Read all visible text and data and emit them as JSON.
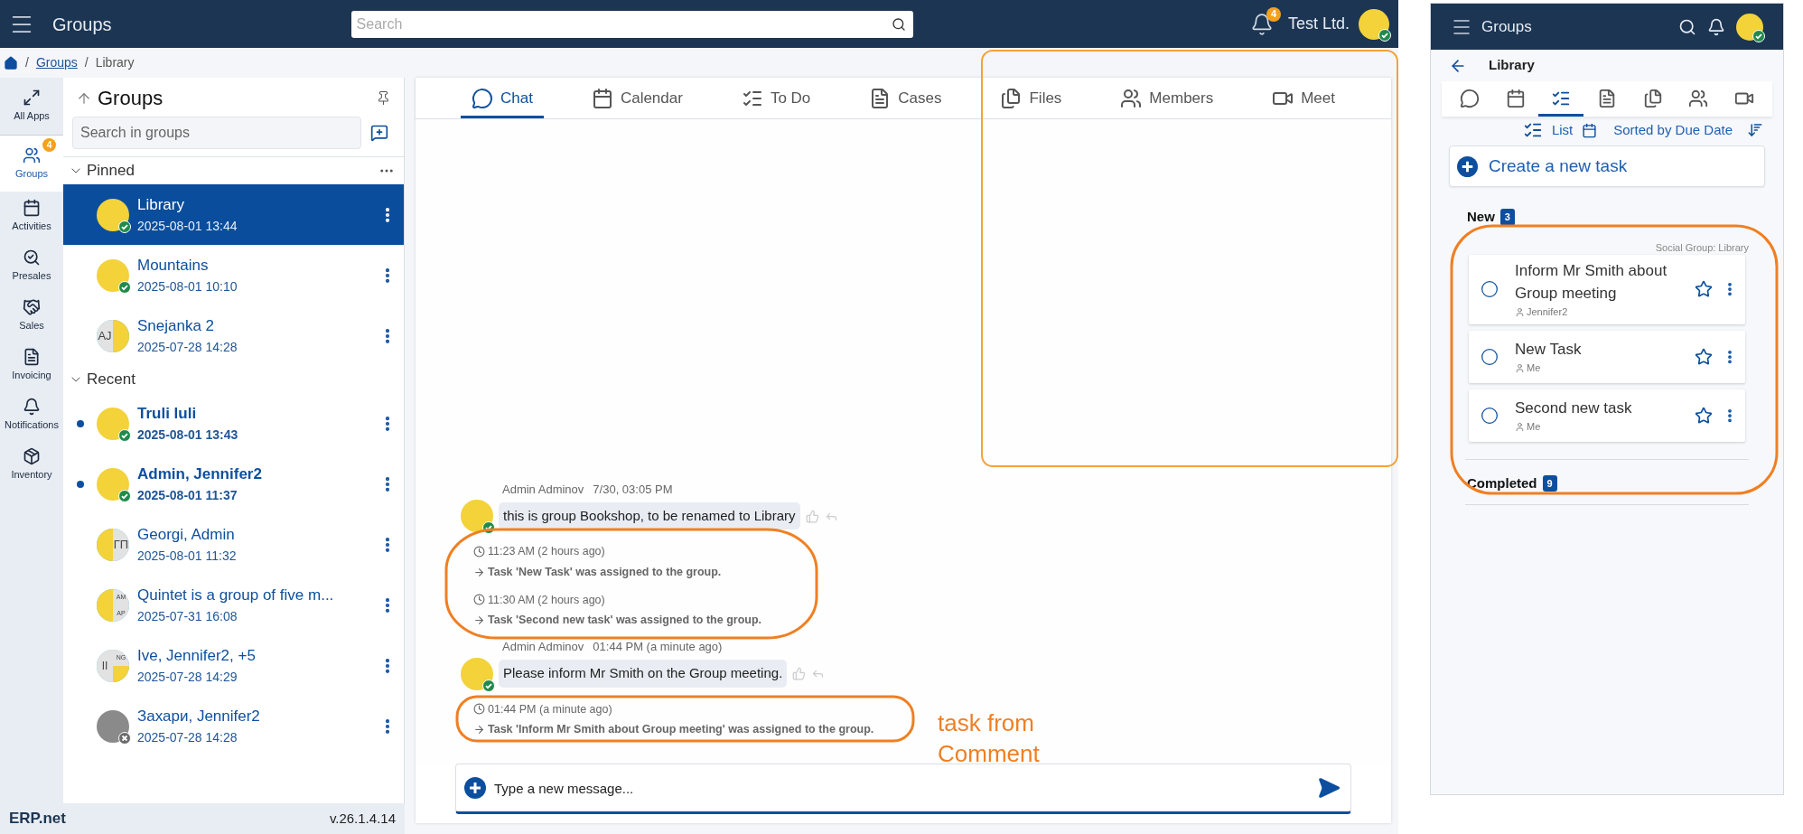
{
  "app_bar": {
    "title": "Groups",
    "search_placeholder": "Search",
    "notifications_count": "4",
    "company": "Test Ltd."
  },
  "breadcrumb": [
    {
      "kind": "separator",
      "text": "/"
    },
    {
      "kind": "link",
      "text": "Groups"
    },
    {
      "kind": "separator",
      "text": "/"
    },
    {
      "kind": "current",
      "text": "Library"
    }
  ],
  "rail": [
    {
      "label": "All Apps",
      "selected": false
    },
    {
      "label": "Groups",
      "selected": true,
      "badge": "4"
    },
    {
      "label": "Activities",
      "selected": false
    },
    {
      "label": "Presales",
      "selected": false
    },
    {
      "label": "Sales",
      "selected": false
    },
    {
      "label": "Invoicing",
      "selected": false
    },
    {
      "label": "Notifications",
      "selected": false
    },
    {
      "label": "Inventory",
      "selected": false
    }
  ],
  "group_list": {
    "title": "Groups",
    "search_placeholder": "Search in groups",
    "sections": [
      {
        "title": "Pinned",
        "expanded": true,
        "items": [
          {
            "name": "Library",
            "date": "2025-08-01 13:44",
            "selected": true,
            "unread": false,
            "online": true,
            "offline": false,
            "avatar": [
              {
                "kind": "picture"
              }
            ]
          },
          {
            "name": "Mountains",
            "date": "2025-08-01 10:10",
            "selected": false,
            "unread": false,
            "online": true,
            "offline": false,
            "avatar": [
              {
                "kind": "picture"
              }
            ]
          },
          {
            "name": "Snejanka 2",
            "date": "2025-07-28 14:28",
            "selected": false,
            "unread": false,
            "online": false,
            "offline": false,
            "avatar": [
              {
                "kind": "initials",
                "text": "AJ"
              },
              {
                "kind": "picture"
              }
            ]
          }
        ]
      },
      {
        "title": "Recent",
        "expanded": true,
        "items": [
          {
            "name": "Truli luli",
            "date": "2025-08-01 13:43",
            "selected": false,
            "unread": true,
            "online": true,
            "offline": false,
            "avatar": [
              {
                "kind": "picture"
              }
            ]
          },
          {
            "name": "Admin, Jennifer2",
            "date": "2025-08-01 11:37",
            "selected": false,
            "unread": true,
            "online": true,
            "offline": false,
            "avatar": [
              {
                "kind": "picture"
              }
            ]
          },
          {
            "name": "Georgi, Admin",
            "date": "2025-08-01 11:32",
            "selected": false,
            "unread": false,
            "online": false,
            "offline": false,
            "avatar": [
              {
                "kind": "picture"
              },
              {
                "kind": "initials",
                "text": "ГП"
              }
            ]
          },
          {
            "name": "Quintet is a group of five m...",
            "date": "2025-07-31 16:08",
            "selected": false,
            "unread": false,
            "online": false,
            "offline": false,
            "avatar": [
              {
                "kind": "picture"
              },
              {
                "kind": "initials",
                "text": "AM"
              },
              {
                "kind": "initials",
                "text": "AP"
              }
            ]
          },
          {
            "name": "Ive, Jennifer2, +5",
            "date": "2025-07-28 14:29",
            "selected": false,
            "unread": false,
            "online": false,
            "offline": false,
            "avatar": [
              {
                "kind": "initials",
                "text": "II"
              },
              {
                "kind": "initials",
                "text": "NG"
              },
              {
                "kind": "picture"
              }
            ]
          },
          {
            "name": "Захари, Jennifer2",
            "date": "2025-07-28 14:28",
            "selected": false,
            "unread": false,
            "online": false,
            "offline": true,
            "avatar": [
              {
                "kind": "photo"
              }
            ]
          }
        ]
      }
    ]
  },
  "footer": {
    "logo": "ERP.net",
    "version": "v.26.1.4.14"
  },
  "chat": {
    "tabs": [
      {
        "label": "Chat",
        "selected": true
      },
      {
        "label": "Calendar",
        "selected": false
      },
      {
        "label": "To Do",
        "selected": false
      },
      {
        "label": "Cases",
        "selected": false
      },
      {
        "label": "Files",
        "selected": false
      },
      {
        "label": "Members",
        "selected": false
      },
      {
        "label": "Meet",
        "selected": false
      }
    ],
    "messages": [
      {
        "kind": "message",
        "author": "Admin Adminov",
        "time": "7/30, 03:05 PM",
        "text": "this is group Bookshop, to be renamed to Library"
      },
      {
        "kind": "event",
        "time": "11:23 AM (2 hours ago)",
        "text": "Task 'New Task' was assigned to the group."
      },
      {
        "kind": "event",
        "time": "11:30 AM (2 hours ago)",
        "text": "Task 'Second new task' was assigned to the group."
      },
      {
        "kind": "message",
        "author": "Admin Adminov",
        "time": "01:44 PM (a minute ago)",
        "text": "Please inform Mr Smith on the Group meeting."
      },
      {
        "kind": "event",
        "time": "01:44 PM (a minute ago)",
        "text": "Task 'Inform Mr Smith about Group meeting' was assigned to the group."
      }
    ],
    "composer_placeholder": "Type a new message..."
  },
  "annotation": {
    "lines": [
      "task from",
      "Comment"
    ]
  },
  "task_panel": {
    "title": "Groups",
    "group": "Library",
    "tabs": [
      {
        "selected": false
      },
      {
        "selected": false
      },
      {
        "selected": true
      },
      {
        "selected": false
      },
      {
        "selected": false
      },
      {
        "selected": false
      },
      {
        "selected": false
      }
    ],
    "view": "List",
    "sort": "Sorted by Due Date",
    "create_label": "Create a new task",
    "new_section": {
      "title": "New",
      "count": "3"
    },
    "source": "Social Group: Library",
    "tasks": [
      {
        "title": "Inform Mr Smith about Group meeting",
        "assignee": "Jennifer2",
        "done": false,
        "starred": false
      },
      {
        "title": "New Task",
        "assignee": "Me",
        "done": false,
        "starred": false
      },
      {
        "title": "Second new task",
        "assignee": "Me",
        "done": false,
        "starred": false
      }
    ],
    "completed_section": {
      "title": "Completed",
      "count": "9"
    }
  }
}
